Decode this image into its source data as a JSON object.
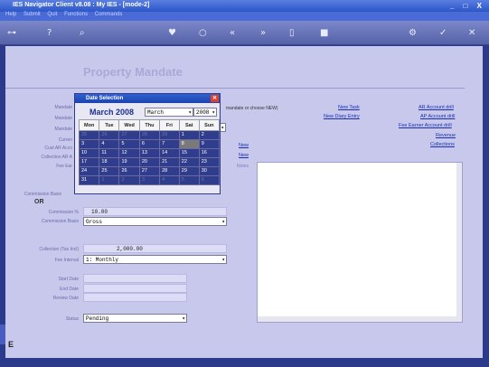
{
  "window": {
    "title": "IES Navigator Client v8.08 : My IES - [mode-2]",
    "controls": "_ □ X"
  },
  "menu": [
    "Help",
    "Submit",
    "Quit",
    "Functions",
    "Commands"
  ],
  "page_title": "Property Mandate",
  "calendar": {
    "title": "Date Selection",
    "month_label": "March 2008",
    "month_value": "March",
    "year_value": "2008",
    "days": [
      "Mon",
      "Tue",
      "Wed",
      "Thu",
      "Fri",
      "Sat",
      "Sun"
    ],
    "weeks": [
      [
        "25",
        "26",
        "27",
        "28",
        "29",
        "1",
        "2"
      ],
      [
        "3",
        "4",
        "5",
        "6",
        "7",
        "8",
        "9"
      ],
      [
        "10",
        "11",
        "12",
        "13",
        "14",
        "15",
        "16"
      ],
      [
        "17",
        "18",
        "19",
        "20",
        "21",
        "22",
        "23"
      ],
      [
        "24",
        "25",
        "26",
        "27",
        "28",
        "29",
        "30"
      ],
      [
        "31",
        "1",
        "2",
        "3",
        "4",
        "5",
        "6"
      ]
    ]
  },
  "partial_labels": {
    "t1": "Mandate",
    "t2": "Mandate",
    "t3": "Mandate",
    "t4": "Curren",
    "t5": "Cust AR Acco",
    "t6": "Collection AR A",
    "t7": "Fee Ear"
  },
  "help_text": "mandate or choose NEW)",
  "links": {
    "new_task": "New Task",
    "new_diary": "New Diary Entry",
    "new1": "New",
    "new2": "New",
    "ar_account": "AR Account drill",
    "ap_account": "AP Account drill",
    "fee_earner": "Fee Earner Account drill",
    "revenue": "Revenue",
    "collections": "Collections"
  },
  "notes_label": "Notes",
  "form": {
    "commission_label": "Commission Basis",
    "or_label": "OR",
    "commission_pct_label": "Commission %",
    "commission_pct_value": "10.00",
    "commission_basis_label": "Commission Basis",
    "commission_basis_value": "Gross",
    "collection_label": "Collection (Tax Incl)",
    "collection_value": "2,000.00",
    "fee_interval_label": "Fee Interval",
    "fee_interval_value": "1: Monthly",
    "start_date_label": "Start Date",
    "end_date_label": "End Date",
    "review_date_label": "Review Date",
    "status_label": "Status",
    "status_value": "Pending"
  },
  "side_label": "E"
}
